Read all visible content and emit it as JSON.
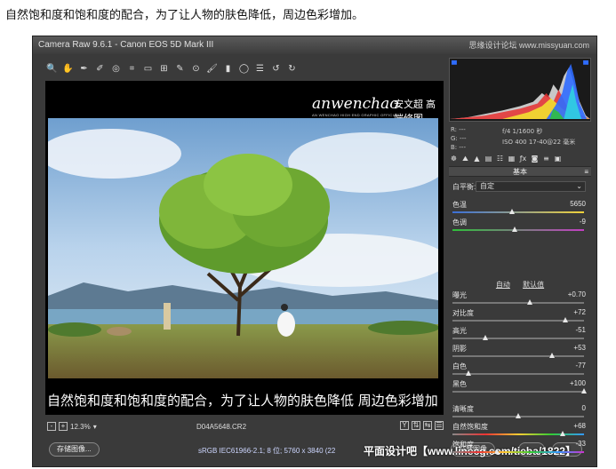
{
  "caption_top": "自然饱和度和饱和度的配合，为了让人物的肤色降低，周边色彩增加。",
  "window": {
    "title": "Camera Raw 9.6.1 - Canon EOS 5D Mark III",
    "watermark_site": "思缘设计论坛 www.missyuan.com"
  },
  "toolbar": {
    "tools": [
      "zoom-icon",
      "hand-icon",
      "eyedropper-icon",
      "color-sampler-icon",
      "target-adjust-icon",
      "crop-icon",
      "straighten-icon",
      "transform-icon",
      "spot-removal-icon",
      "red-eye-icon",
      "adjustment-brush-icon",
      "graduated-filter-icon",
      "radial-filter-icon",
      "preferences-icon",
      "rotate-ccw-icon",
      "rotate-cw-icon"
    ],
    "glyphs": [
      "🔍",
      "✋",
      "✒",
      "✐",
      "◎",
      "⌗",
      "▭",
      "⊞",
      "✎",
      "⊙",
      "🖌",
      "▮",
      "◯",
      "☰",
      "↺",
      "↻"
    ],
    "fullscreen_glyph": "⤢"
  },
  "canvas": {
    "brand": "anwenchao",
    "brand_cn": "安文超 高端修图",
    "brand_sub": "AN WENCHAO HIGH END GRAPHIC OFFICIAL WEBSITE/WWW.ANWENCHAO.COM"
  },
  "caption_bottom": "自然饱和度和饱和度的配合，为了让人物的肤色降低  周边色彩增加",
  "status": {
    "zoom_minus": "-",
    "zoom_plus": "+",
    "zoom": "12.3%",
    "zoom_arrow": "▾",
    "filename": "D04A5648.CR2",
    "view_icons": [
      "Y",
      "⇅",
      "⇆",
      "☰"
    ]
  },
  "bottom": {
    "save_label": "存储图像...",
    "workflow": "sRGB IEC61966-2.1; 8 位; 5760 x 3840 (22",
    "open_label": "打开图像",
    "watermark": "平面设计吧【www.linecg.com/tieba/1822】"
  },
  "info": {
    "r": "R:  ---",
    "g": "G:  ---",
    "b": "B:  ---",
    "exif_line1": "f/4   1/1600 秒",
    "exif_line2": "ISO 400   17-40@22 毫米"
  },
  "panel_icons": [
    "☸",
    "⛰",
    "▲",
    "▤",
    "☷",
    "▦",
    "ƒx",
    "◙",
    "≡",
    "▣"
  ],
  "panel": {
    "title": "基本",
    "menu_glyph": "≡",
    "wb_label": "白平衡:",
    "wb_value": "自定",
    "auto": "自动",
    "default": "默认值"
  },
  "sliders_top": [
    {
      "label": "色温",
      "value": "5650",
      "position": 0.45,
      "track": "linear-gradient(90deg,#3a6fd8,#f0d23a)"
    },
    {
      "label": "色调",
      "value": "-9",
      "position": 0.47,
      "track": "linear-gradient(90deg,#2fbf3a,#c23fc2)"
    }
  ],
  "sliders_tone": [
    {
      "label": "曝光",
      "value": "+0.70",
      "position": 0.59
    },
    {
      "label": "对比度",
      "value": "+72",
      "position": 0.86
    },
    {
      "label": "高光",
      "value": "-51",
      "position": 0.25
    },
    {
      "label": "阴影",
      "value": "+53",
      "position": 0.76
    },
    {
      "label": "白色",
      "value": "-77",
      "position": 0.12
    },
    {
      "label": "黑色",
      "value": "+100",
      "position": 1.0
    }
  ],
  "sliders_presence": [
    {
      "label": "清晰度",
      "value": "0",
      "position": 0.5
    },
    {
      "label": "自然饱和度",
      "value": "+68",
      "position": 0.84,
      "track": "linear-gradient(90deg,#888,#e33,#fc3,#3c3,#39f)"
    },
    {
      "label": "饱和度",
      "value": "-33",
      "position": 0.34,
      "track": "linear-gradient(90deg,#888,#e33,#fc3,#3c3,#39f,#c3c)"
    }
  ]
}
